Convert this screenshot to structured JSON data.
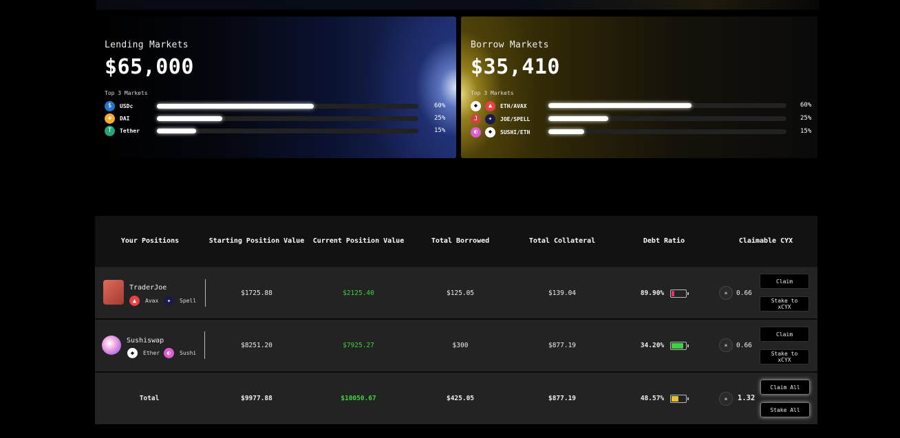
{
  "lending": {
    "title": "Lending Markets",
    "amount": "$65,000",
    "subtitle": "Top 3 Markets",
    "markets": [
      {
        "name": "USDc",
        "pct": "60%",
        "fill": 0.6,
        "icon": "usdc-icon",
        "color": "#2775ca"
      },
      {
        "name": "DAI",
        "pct": "25%",
        "fill": 0.25,
        "icon": "dai-icon",
        "color": "#f5ac37"
      },
      {
        "name": "Tether",
        "pct": "15%",
        "fill": 0.15,
        "icon": "tether-icon",
        "color": "#26a17b"
      }
    ]
  },
  "borrow": {
    "title": "Borrow Markets",
    "amount": "$35,410",
    "subtitle": "Top 3 Markets",
    "markets": [
      {
        "name": "ETH/AVAX",
        "pct": "60%",
        "fill": 0.6
      },
      {
        "name": "JOE/SPELL",
        "pct": "25%",
        "fill": 0.25
      },
      {
        "name": "SUSHI/ETH",
        "pct": "15%",
        "fill": 0.15
      }
    ]
  },
  "table": {
    "headers": [
      "Your Positions",
      "Starting Position Value",
      "Current Position Value",
      "Total Borrowed",
      "Total Collateral",
      "Debt Ratio",
      "Claimable CYX"
    ],
    "rows": [
      {
        "protocol": "TraderJoe",
        "tokens": [
          "Avax",
          "Spell"
        ],
        "starting": "$1725.88",
        "current": "$2125.40",
        "borrowed": "$125.05",
        "collateral": "$139.04",
        "debt_ratio": "89.90%",
        "debt_level": 0.2,
        "debt_color": "#e8307a",
        "claimable": "0.66",
        "claim_label": "Claim",
        "stake_label": "Stake to xCYX"
      },
      {
        "protocol": "Sushiswap",
        "tokens": [
          "Ether",
          "Sushi"
        ],
        "starting": "$8251.20",
        "current": "$7925.27",
        "borrowed": "$300",
        "collateral": "$877.19",
        "debt_ratio": "34.20%",
        "debt_level": 0.85,
        "debt_color": "#3fd13f",
        "claimable": "0.66",
        "claim_label": "Claim",
        "stake_label": "Stake to xCYX"
      }
    ],
    "total": {
      "label": "Total",
      "starting": "$9977.88",
      "current": "$10050.67",
      "borrowed": "$425.05",
      "collateral": "$877.19",
      "debt_ratio": "48.57%",
      "debt_level": 0.5,
      "debt_color": "#e7c030",
      "claimable": "1.32",
      "claim_label": "Claim All",
      "stake_label": "Stake All"
    }
  }
}
